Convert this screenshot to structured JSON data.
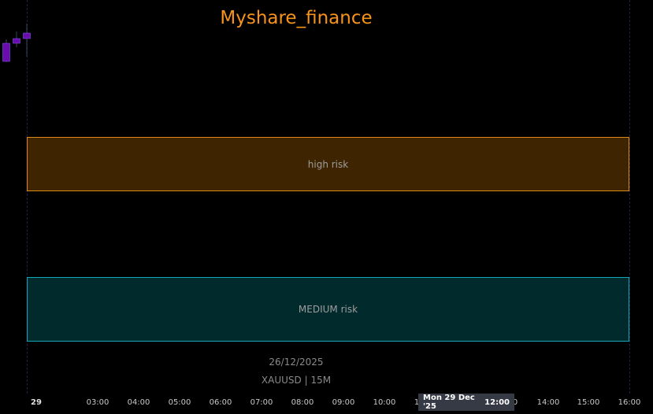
{
  "chart_data": {
    "type": "candlestick",
    "title": "Myshare_finance",
    "symbol_label": "XAUUSD | 15M",
    "date_label": "26/12/2025",
    "zones": [
      {
        "label": "high risk",
        "fill": "#3e2400",
        "border": "#e08a12"
      },
      {
        "label": "MEDIUM risk",
        "fill": "#012a2c",
        "border": "#11a9b7"
      }
    ],
    "x_tick_labels": [
      "29",
      "03:00",
      "04:00",
      "05:00",
      "06:00",
      "07:00",
      "08:00",
      "09:00",
      "10:00",
      "1",
      "0",
      "14:00",
      "15:00",
      "16:00"
    ],
    "crosshair_label": {
      "date": "Mon 29 Dec '25",
      "time": "12:00"
    },
    "candles": [
      {
        "o": 78,
        "h": 50,
        "l": 79,
        "c": 55,
        "color": "#6a0dad"
      },
      {
        "o": 55,
        "h": 40,
        "l": 60,
        "c": 49,
        "color": "#6a0dad"
      },
      {
        "o": 49,
        "h": 30,
        "l": 72,
        "c": 42,
        "color": "#6a0dad"
      }
    ],
    "colors": {
      "title": "#f7931a",
      "background": "#000000",
      "candle": "#6a0dad"
    }
  }
}
